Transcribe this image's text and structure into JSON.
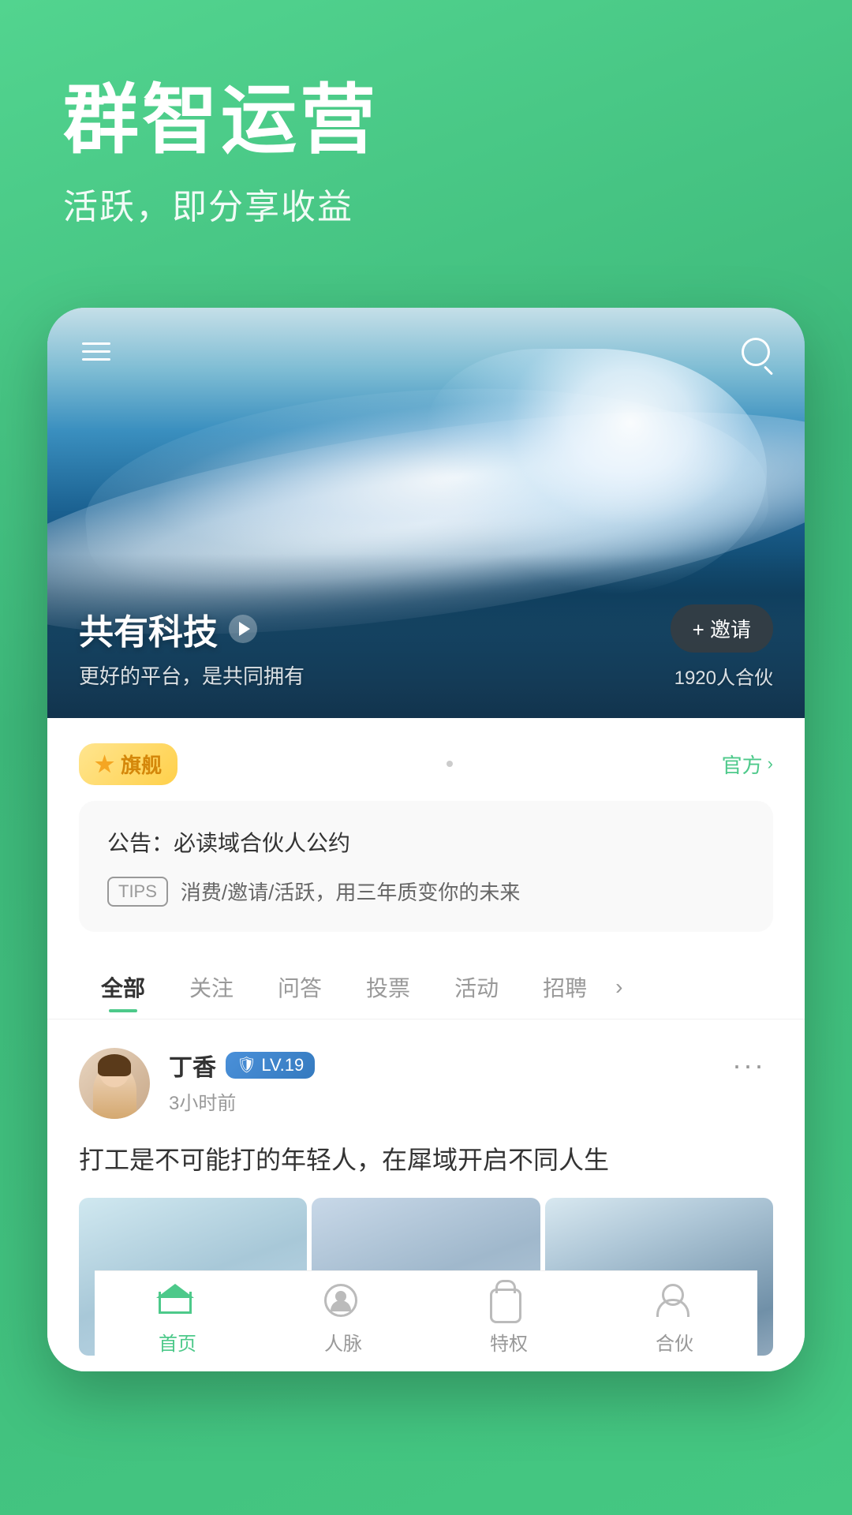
{
  "background": {
    "color": "#4dc98a"
  },
  "hero_header": {
    "main_title": "群智运营",
    "sub_title": "活跃，即分享收益"
  },
  "hero_image": {
    "menu_icon": "≡",
    "search_icon": "🔍",
    "group_name": "共有科技",
    "group_subtitle": "更好的平台，是共同拥有",
    "invite_btn": "+ 邀请",
    "partner_count": "1920人合伙"
  },
  "badge_row": {
    "flagship_label": "旗舰",
    "official_label": "官方",
    "dot": "·"
  },
  "announcement": {
    "title": "公告：必读域合伙人公约",
    "tips_badge": "TIPS",
    "tips_text": "消费/邀请/活跃，用三年质变你的未来"
  },
  "tabs": [
    {
      "label": "全部",
      "active": true
    },
    {
      "label": "关注",
      "active": false
    },
    {
      "label": "问答",
      "active": false
    },
    {
      "label": "投票",
      "active": false
    },
    {
      "label": "活动",
      "active": false
    },
    {
      "label": "招聘",
      "active": false
    }
  ],
  "post": {
    "user_name": "丁香",
    "level": "LV.19",
    "time": "3小时前",
    "content": "打工是不可能打的年轻人，在犀域开启不同人生",
    "more_icon": "···"
  },
  "bottom_nav": [
    {
      "label": "首页",
      "active": true
    },
    {
      "label": "人脉",
      "active": false
    },
    {
      "label": "特权",
      "active": false
    },
    {
      "label": "合伙",
      "active": false
    }
  ]
}
